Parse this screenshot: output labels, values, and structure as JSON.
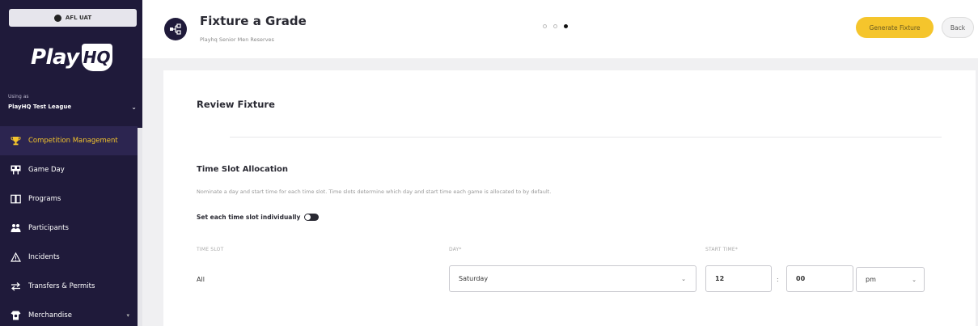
{
  "sidebar": {
    "env_label": "AFL UAT",
    "logo_play": "Play",
    "logo_hq": "HQ",
    "using_label": "Using as",
    "org_name": "PlayHQ Test League",
    "items": [
      {
        "label": "Competition Management",
        "icon": "trophy-icon",
        "active": true
      },
      {
        "label": "Game Day",
        "icon": "scoreboard-icon",
        "active": false
      },
      {
        "label": "Programs",
        "icon": "book-icon",
        "active": false
      },
      {
        "label": "Participants",
        "icon": "people-icon",
        "active": false
      },
      {
        "label": "Incidents",
        "icon": "warning-icon",
        "active": false
      },
      {
        "label": "Transfers & Permits",
        "icon": "transfer-icon",
        "active": false
      },
      {
        "label": "Merchandise",
        "icon": "merchandise-icon",
        "active": false
      }
    ]
  },
  "header": {
    "title": "Fixture a Grade",
    "subtitle": "Playhq Senior Men Reserves",
    "step_count": 3,
    "active_step": 3,
    "generate_label": "Generate Fixture",
    "back_label": "Back"
  },
  "review": {
    "title": "Review Fixture"
  },
  "time_slot": {
    "title": "Time Slot Allocation",
    "description": "Nominate a day and start time for each time slot. Time slots determine which day and start time each game is allocated to by default.",
    "toggle_label": "Set each time slot individually",
    "toggle_on": false,
    "col_time_slot": "TIME SLOT",
    "col_day": "DAY*",
    "col_start_time": "START TIME*",
    "row_label": "All",
    "day_value": "Saturday",
    "hour_value": "12",
    "colon": ":",
    "minute_value": "00",
    "ampm_value": "pm"
  },
  "colors": {
    "sidebar_bg": "#1f1a3a",
    "accent": "#f5c52c"
  }
}
